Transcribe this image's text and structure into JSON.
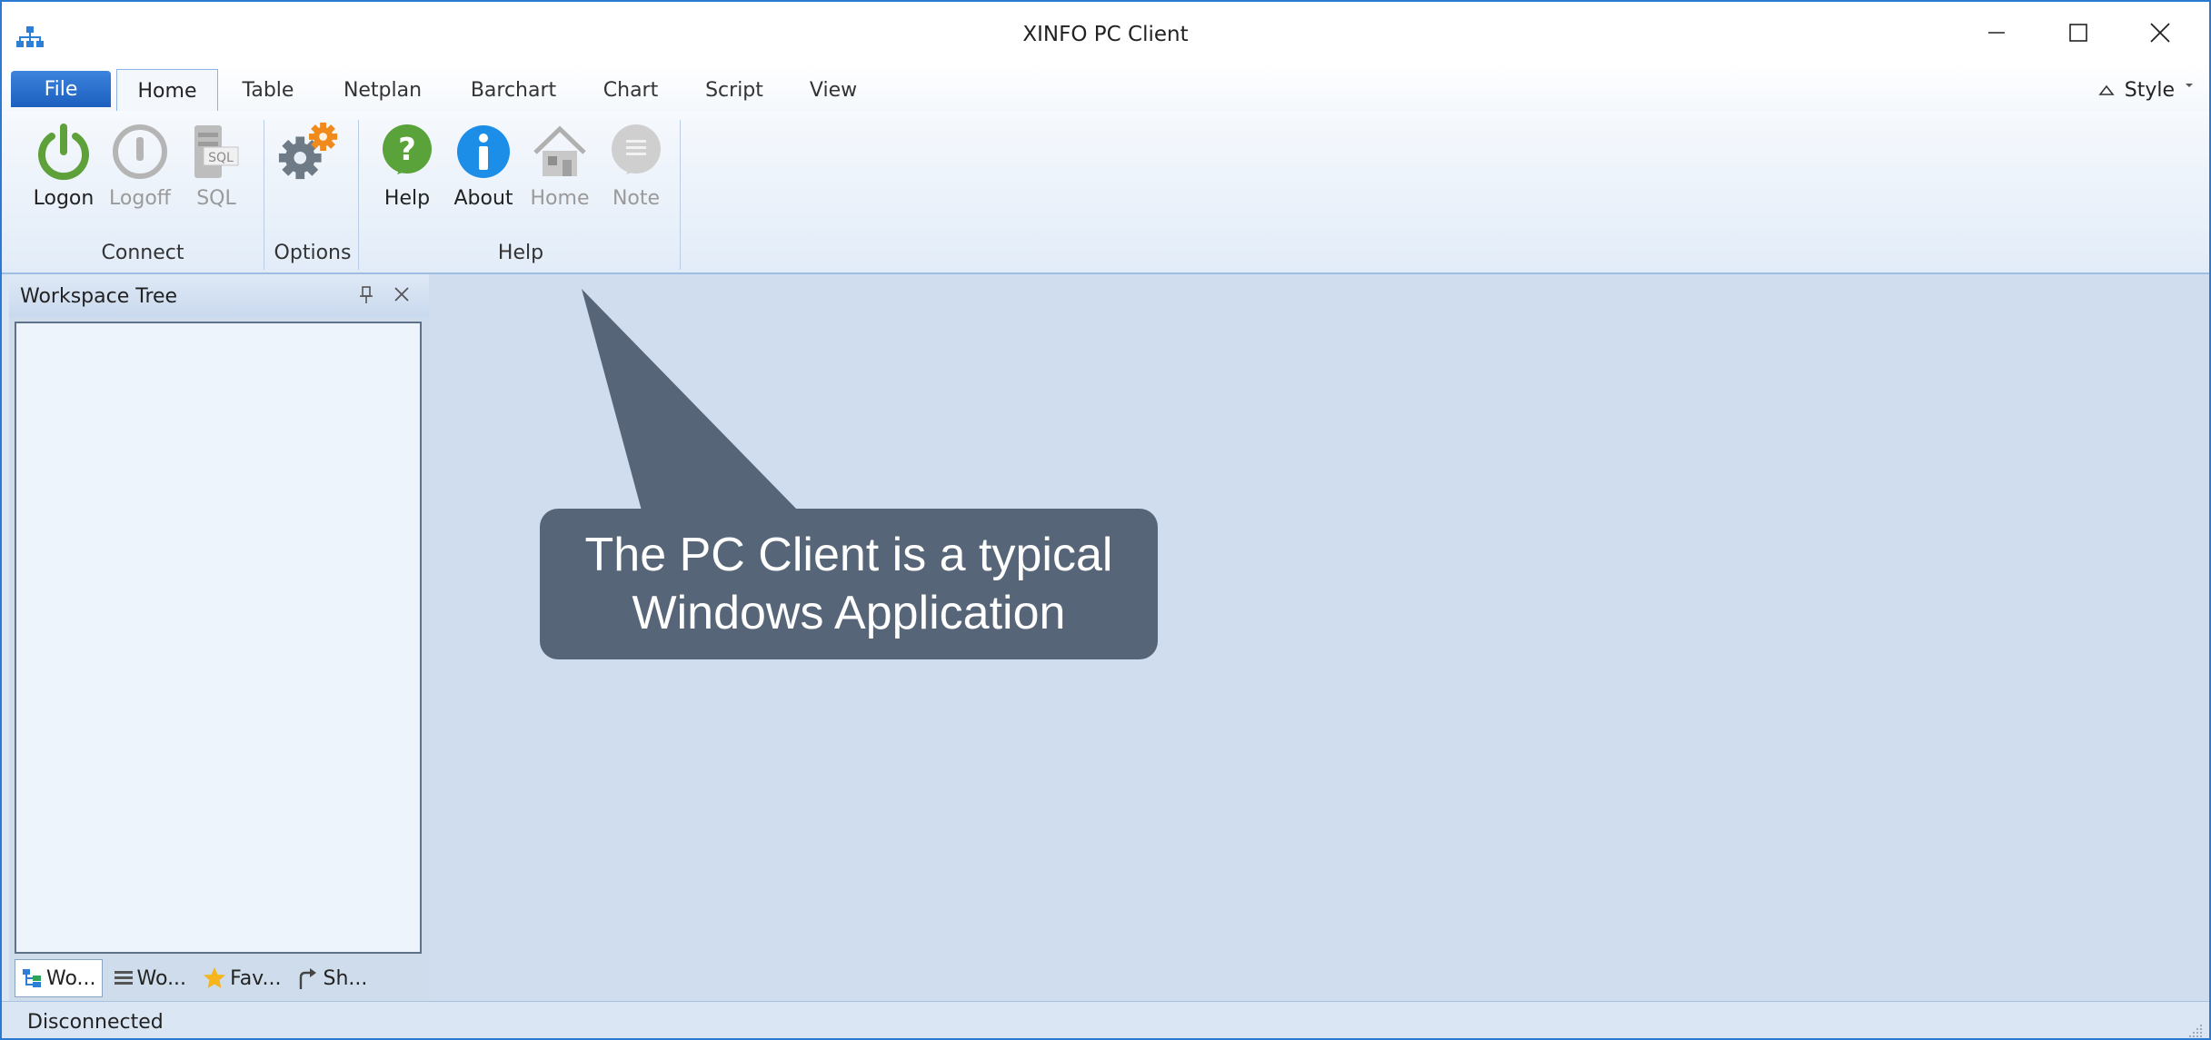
{
  "window": {
    "title": "XINFO PC Client",
    "accent_color": "#2b79d0",
    "controls": [
      "minimize-icon",
      "maximize-icon",
      "close-icon"
    ]
  },
  "ribbon": {
    "file_tab": "File",
    "tabs": [
      "Home",
      "Table",
      "Netplan",
      "Barchart",
      "Chart",
      "Script",
      "View"
    ],
    "active_tab": "Home",
    "style_label": "Style",
    "groups": [
      {
        "label": "Connect",
        "buttons": [
          {
            "label": "Logon",
            "icon": "power-icon",
            "enabled": true
          },
          {
            "label": "Logoff",
            "icon": "power-off-icon",
            "enabled": false
          },
          {
            "label": "SQL",
            "icon": "sql-icon",
            "enabled": false
          }
        ]
      },
      {
        "label": "Options",
        "buttons": [
          {
            "label": "",
            "icon": "gears-icon",
            "enabled": true
          }
        ]
      },
      {
        "label": "Help",
        "buttons": [
          {
            "label": "Help",
            "icon": "question-icon",
            "enabled": true
          },
          {
            "label": "About",
            "icon": "info-icon",
            "enabled": true
          },
          {
            "label": "Home",
            "icon": "home-icon",
            "enabled": false
          },
          {
            "label": "Note",
            "icon": "note-icon",
            "enabled": false
          }
        ]
      }
    ]
  },
  "workspace_panel": {
    "title": "Workspace Tree",
    "tabs": [
      {
        "label": "Wo...",
        "icon": "tree-icon"
      },
      {
        "label": "Wo...",
        "icon": "list-icon"
      },
      {
        "label": "Fav...",
        "icon": "star-icon"
      },
      {
        "label": "Sh...",
        "icon": "share-icon"
      }
    ]
  },
  "callout": {
    "line1": "The PC Client is a typical",
    "line2": "Windows Application"
  },
  "statusbar": {
    "text": "Disconnected"
  }
}
